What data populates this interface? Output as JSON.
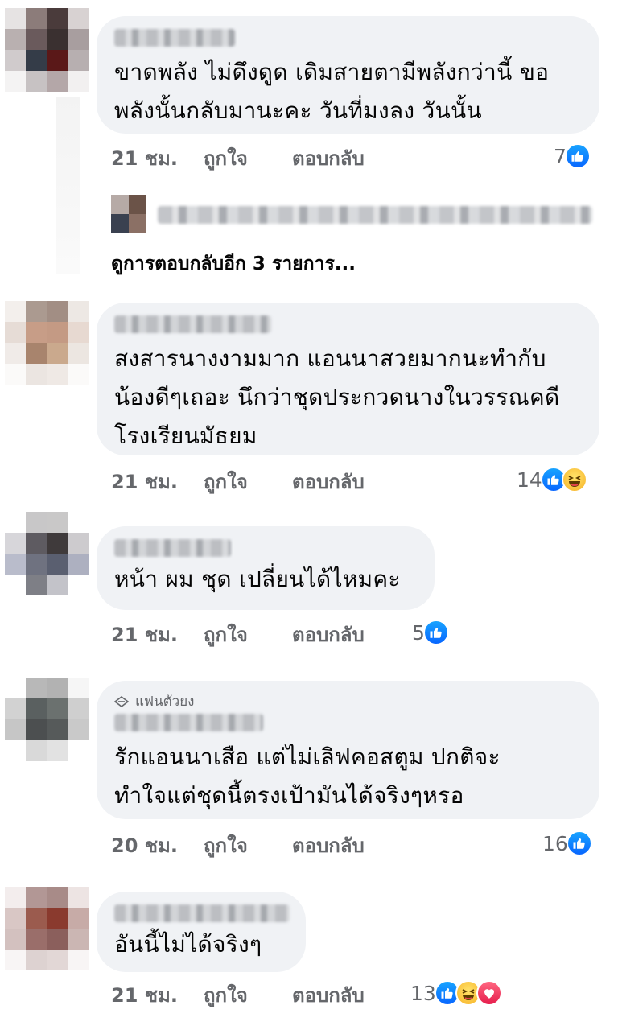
{
  "comments": [
    {
      "text": "ขาดพลัง ไม่ดึงดูด เดิมสายตามีพลังกว่านี้  ขอ\nพลังนั้นกลับมานะคะ วันที่มงลง วันนั้น",
      "time": "21 ชม.",
      "like_label": "ถูกใจ",
      "reply_label": "ตอบกลับ",
      "reaction_count": "7",
      "reactions": [
        "like"
      ]
    },
    {
      "text": "สงสารนางงามมาก แอนนาสวยมากนะทำกับ\nน้องดีๆเถอะ นึกว่าชุดประกวดนางในวรรณคดี\nโรงเรียนมัธยม",
      "time": "21 ชม.",
      "like_label": "ถูกใจ",
      "reply_label": "ตอบกลับ",
      "reaction_count": "14",
      "reactions": [
        "like",
        "haha"
      ]
    },
    {
      "text": "หน้า ผม ชุด เปลี่ยนได้ไหมคะ",
      "time": "21 ชม.",
      "like_label": "ถูกใจ",
      "reply_label": "ตอบกลับ",
      "reaction_count": "5",
      "reactions": [
        "like"
      ]
    },
    {
      "badge": "แฟนตัวยง",
      "text": "รักแอนนาเสือ  แต่ไม่เลิฟคอสตูม  ปกติจะ\nทำใจแต่ชุดนี้ตรงเป้ามันได้จริงๆหรอ",
      "time": "20 ชม.",
      "like_label": "ถูกใจ",
      "reply_label": "ตอบกลับ",
      "reaction_count": "16",
      "reactions": [
        "like"
      ]
    },
    {
      "text": "อันนี้ไม่ได้จริงๆ",
      "time": "21 ชม.",
      "like_label": "ถูกใจ",
      "reply_label": "ตอบกลับ",
      "reaction_count": "13",
      "reactions": [
        "like",
        "haha",
        "love"
      ]
    }
  ],
  "more_replies_label": "ดูการตอบกลับอีก 3 รายการ...",
  "colors": {
    "bubble_bg": "#f0f2f5",
    "meta_text": "#65676b",
    "like_blue": "#0866ff",
    "haha_yellow": "#f7b125",
    "love_red": "#e61e4d"
  }
}
